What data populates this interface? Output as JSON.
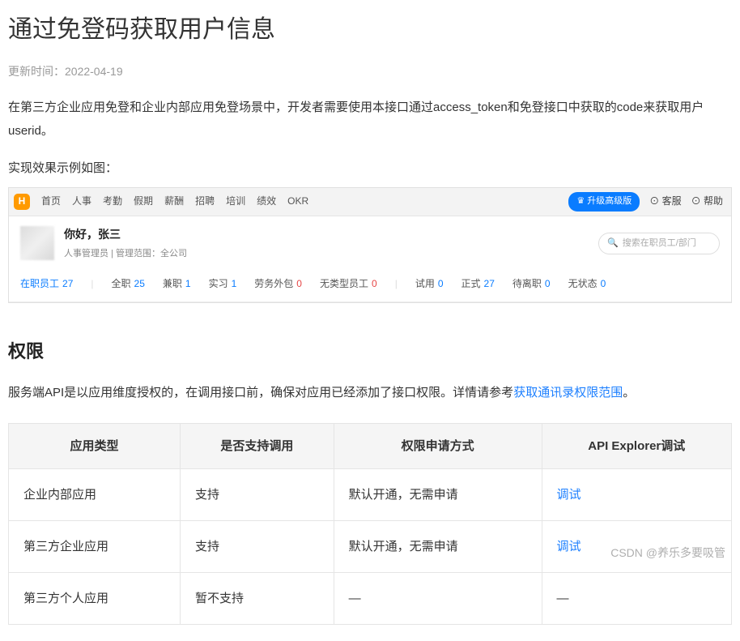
{
  "title": "通过免登码获取用户信息",
  "update_prefix": "更新时间：",
  "update_date": "2022-04-19",
  "intro": "在第三方企业应用免登和企业内部应用免登场景中，开发者需要使用本接口通过access_token和免登接口中获取的code来获取用户userid。",
  "example_label": "实现效果示例如图：",
  "demo": {
    "logo_letter": "H",
    "nav": [
      "首页",
      "人事",
      "考勤",
      "假期",
      "薪酬",
      "招聘",
      "培训",
      "绩效",
      "OKR"
    ],
    "upgrade_label": "升级高级版",
    "kefu_label": "客服",
    "help_label": "帮助",
    "greeting": "你好，张三",
    "role_line": "人事管理员 | 管理范围：全公司",
    "search_placeholder": "搜索在职员工/部门",
    "stats": [
      {
        "label": "在职员工",
        "value": "27",
        "label_color": "blue",
        "num_color": "blue"
      },
      {
        "label": "全职",
        "value": "25",
        "num_color": "blue"
      },
      {
        "label": "兼职",
        "value": "1",
        "num_color": "blue"
      },
      {
        "label": "实习",
        "value": "1",
        "num_color": "blue"
      },
      {
        "label": "劳务外包",
        "value": "0",
        "num_color": "red"
      },
      {
        "label": "无类型员工",
        "value": "0",
        "num_color": "red"
      },
      {
        "label": "试用",
        "value": "0",
        "num_color": "blue"
      },
      {
        "label": "正式",
        "value": "27",
        "num_color": "blue"
      },
      {
        "label": "待离职",
        "value": "0",
        "num_color": "blue"
      },
      {
        "label": "无状态",
        "value": "0",
        "num_color": "blue"
      }
    ]
  },
  "permission": {
    "heading": "权限",
    "desc_prefix": "服务端API是以应用维度授权的，在调用接口前，确保对应用已经添加了接口权限。详情请参考",
    "link_text": "获取通讯录权限范围",
    "desc_suffix": "。",
    "table": {
      "headers": [
        "应用类型",
        "是否支持调用",
        "权限申请方式",
        "API Explorer调试"
      ],
      "rows": [
        {
          "type": "企业内部应用",
          "support": "支持",
          "method": "默认开通，无需申请",
          "debug": "调试",
          "debug_link": true
        },
        {
          "type": "第三方企业应用",
          "support": "支持",
          "method": "默认开通，无需申请",
          "debug": "调试",
          "debug_link": true
        },
        {
          "type": "第三方个人应用",
          "support": "暂不支持",
          "method": "—",
          "debug": "—",
          "debug_link": false
        }
      ]
    }
  },
  "watermark": "CSDN @养乐多要吸管"
}
